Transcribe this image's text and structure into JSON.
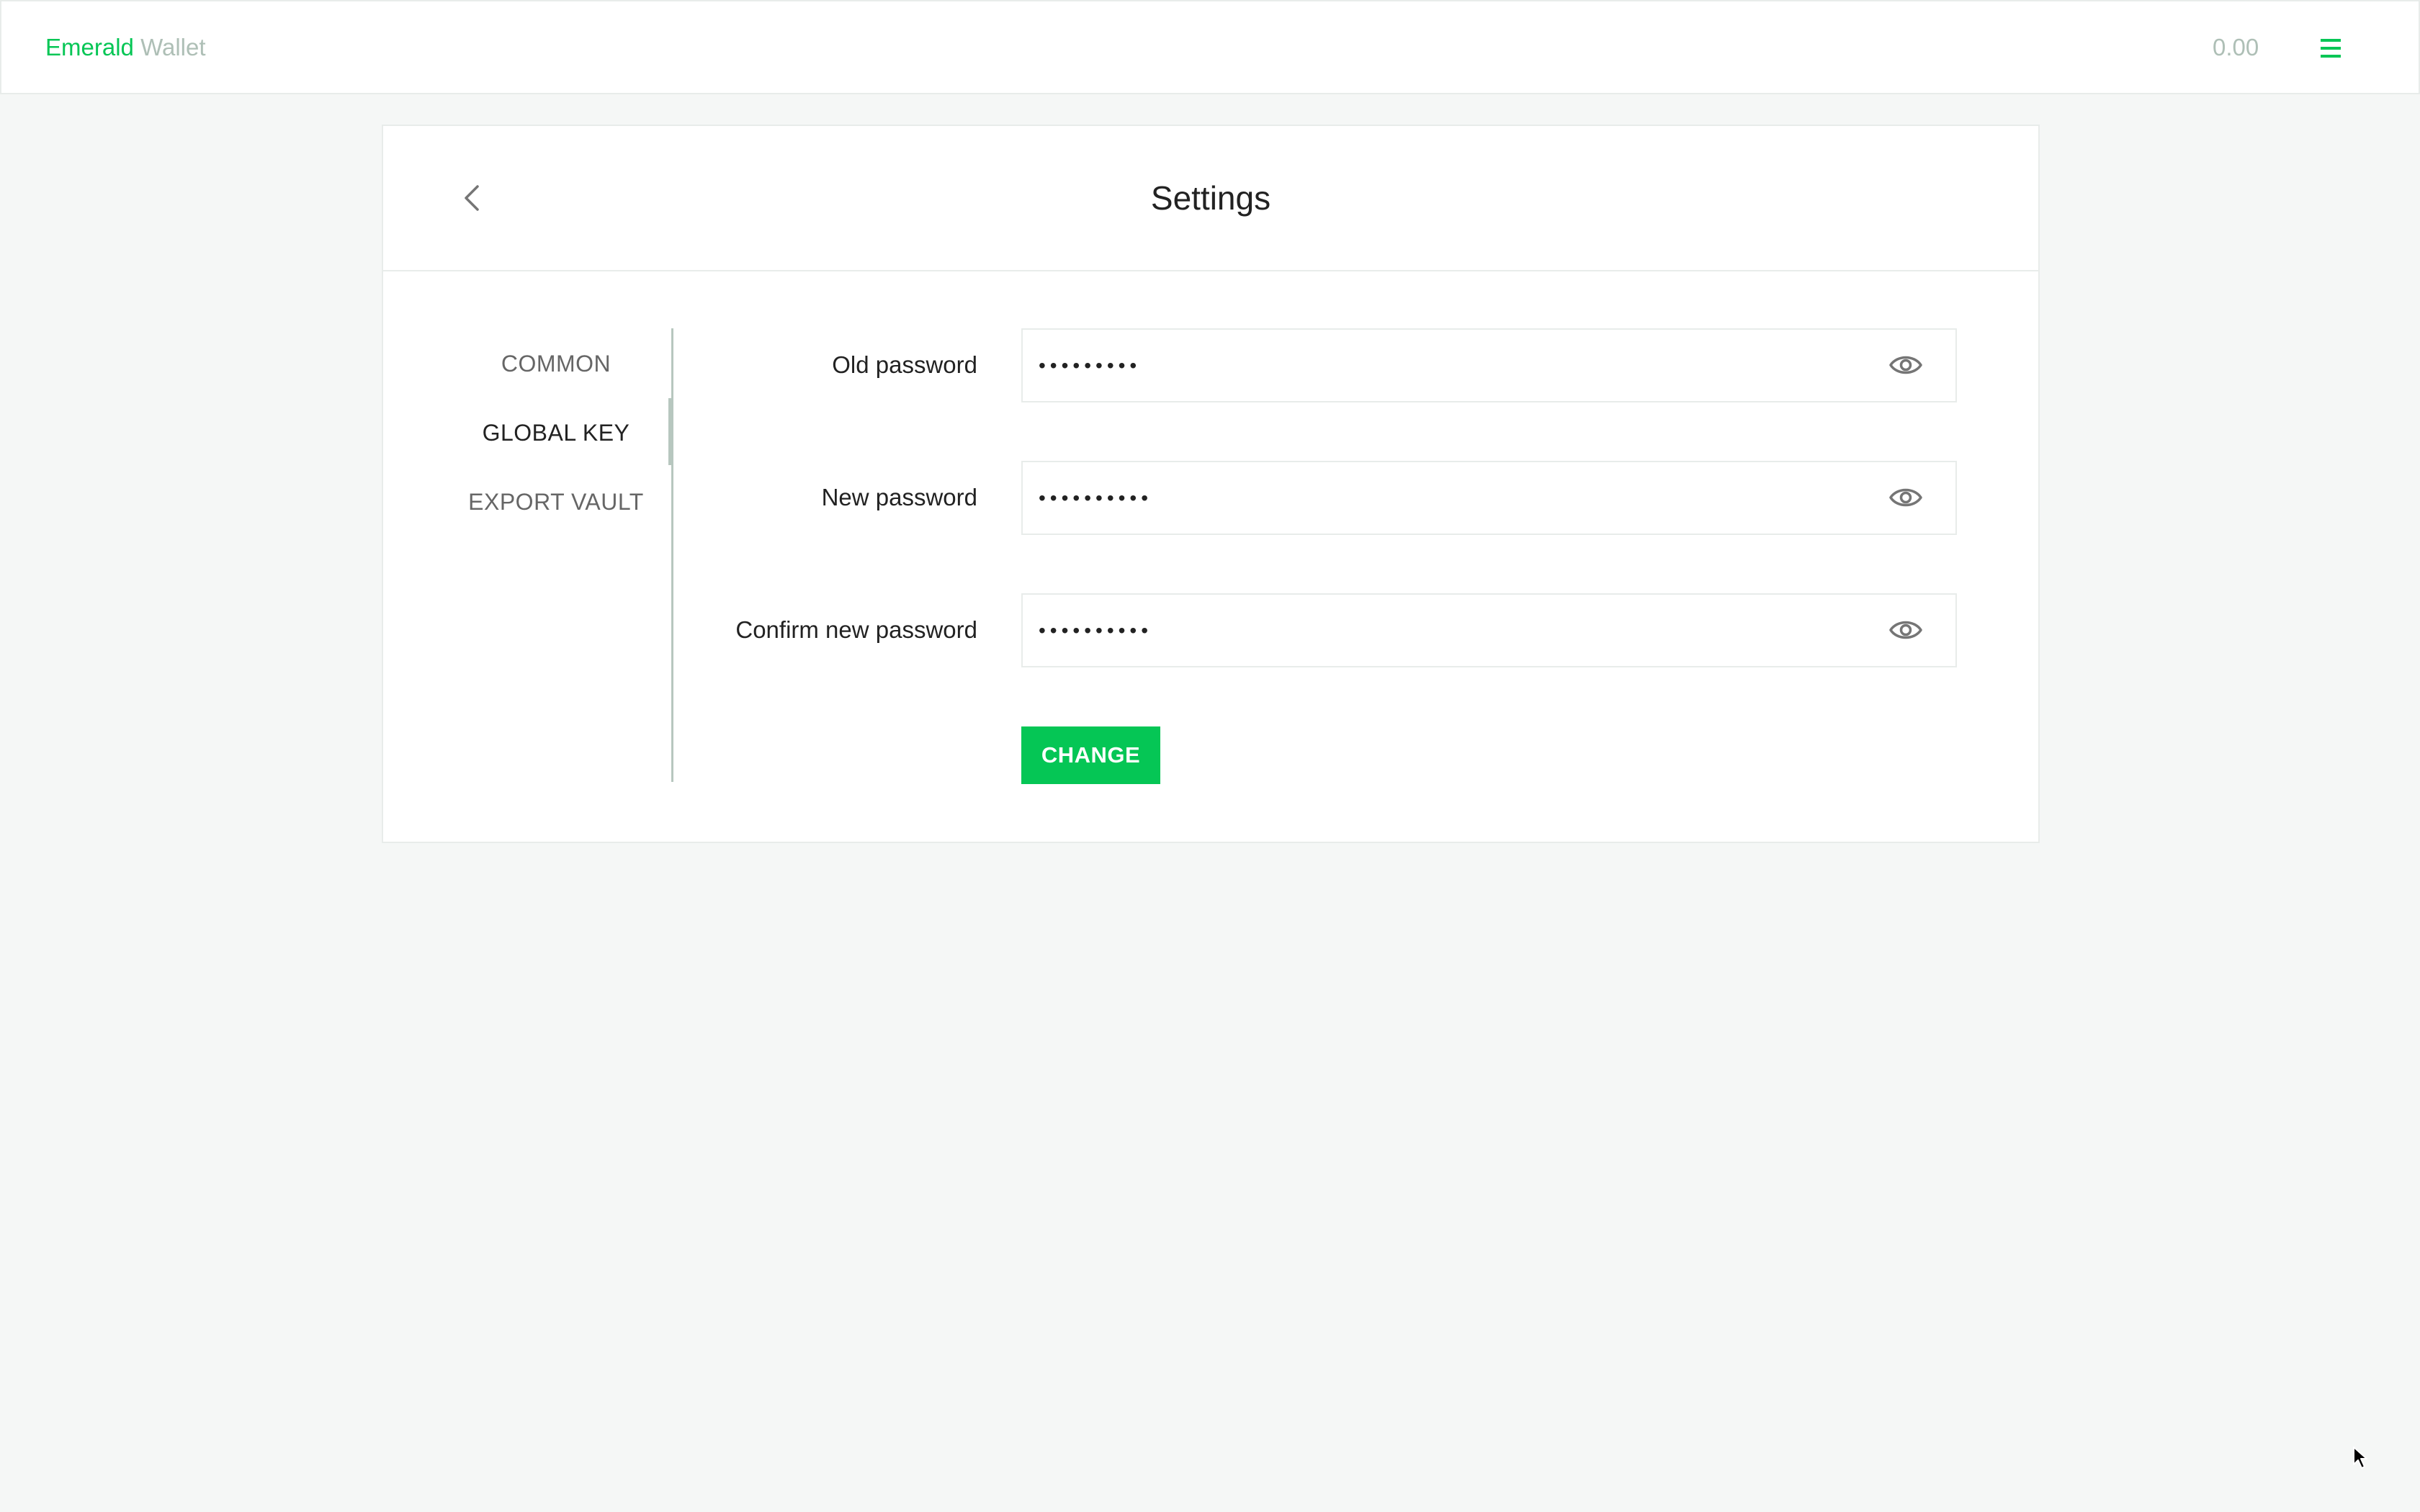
{
  "header": {
    "brand_primary": "Emerald",
    "brand_secondary": "Wallet",
    "balance": "0.00",
    "menu_icon": "hamburger-menu-icon"
  },
  "page": {
    "title": "Settings",
    "back_icon": "chevron-left-icon"
  },
  "sidebar": {
    "active_index": 1,
    "items": [
      {
        "label": "COMMON"
      },
      {
        "label": "GLOBAL KEY"
      },
      {
        "label": "EXPORT VAULT"
      }
    ]
  },
  "form": {
    "fields": [
      {
        "label": "Old password",
        "value": "•••••••••",
        "type": "password",
        "toggle_icon": "eye-icon"
      },
      {
        "label": "New password",
        "value": "••••••••••",
        "type": "password",
        "toggle_icon": "eye-icon"
      },
      {
        "label": "Confirm new password",
        "value": "••••••••••",
        "type": "password",
        "toggle_icon": "eye-icon"
      }
    ],
    "submit_label": "CHANGE"
  },
  "colors": {
    "accent": "#05c655",
    "muted": "#aebfb6",
    "text": "#222222",
    "background": "#f5f7f6",
    "border": "#e8ecea"
  }
}
